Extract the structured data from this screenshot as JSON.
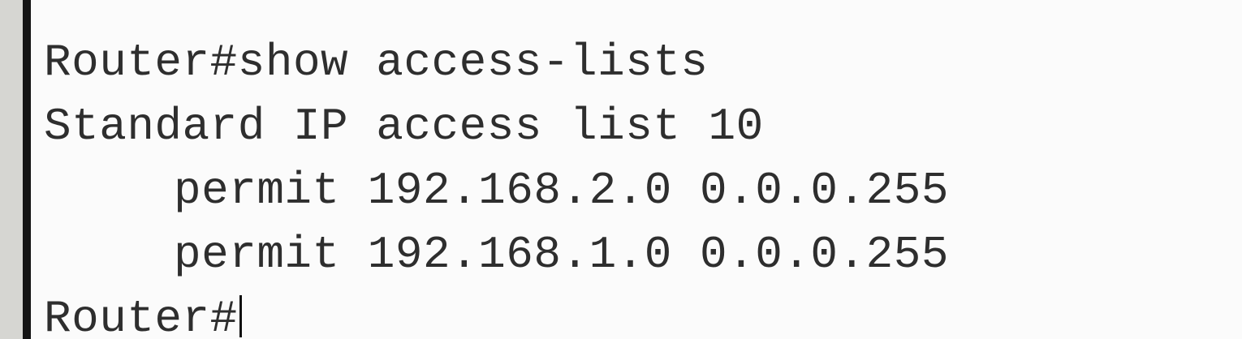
{
  "terminal": {
    "lines": [
      {
        "text": "Router#show access-lists"
      },
      {
        "text": "Standard IP access list 10"
      },
      {
        "text": "permit 192.168.2.0 0.0.0.255"
      },
      {
        "text": "permit 192.168.1.0 0.0.0.255"
      }
    ],
    "prompt": "Router#"
  }
}
